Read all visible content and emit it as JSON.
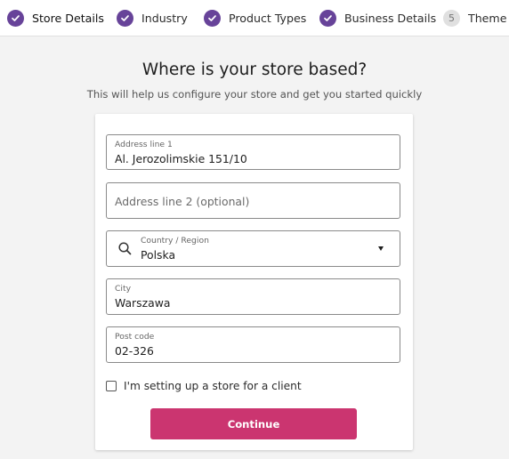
{
  "colors": {
    "accent": "#674399",
    "button": "#cb3570"
  },
  "stepper": {
    "steps": [
      {
        "label": "Store Details",
        "status": "complete",
        "icon": "check-icon"
      },
      {
        "label": "Industry",
        "status": "complete",
        "icon": "check-icon"
      },
      {
        "label": "Product Types",
        "status": "complete",
        "icon": "check-icon"
      },
      {
        "label": "Business Details",
        "status": "complete",
        "icon": "check-icon"
      },
      {
        "label": "Theme",
        "status": "pending",
        "number": "5"
      }
    ]
  },
  "page": {
    "title": "Where is your store based?",
    "subtitle": "This will help us configure your store and get you started quickly"
  },
  "form": {
    "address1": {
      "label": "Address line 1",
      "value": "Al. Jerozolimskie 151/10"
    },
    "address2": {
      "placeholder": "Address line 2 (optional)",
      "value": ""
    },
    "country": {
      "label": "Country / Region",
      "value": "Polska",
      "icon": "search-icon"
    },
    "city": {
      "label": "City",
      "value": "Warszawa"
    },
    "postcode": {
      "label": "Post code",
      "value": "02-326"
    },
    "client_checkbox": {
      "label": "I'm setting up a store for a client",
      "checked": false
    },
    "continue_label": "Continue"
  }
}
